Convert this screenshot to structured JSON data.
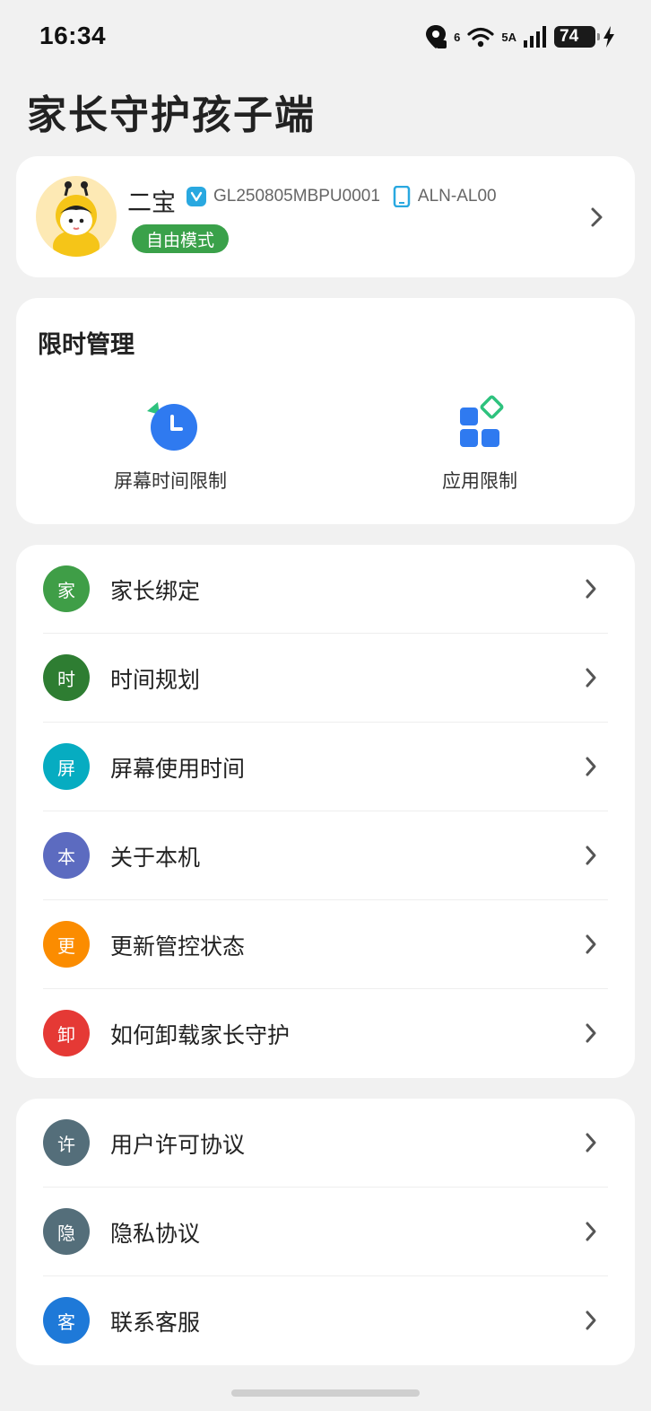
{
  "status_bar": {
    "time": "16:34",
    "network_6": "6",
    "network_5a": "5A",
    "battery": "74"
  },
  "page": {
    "title": "家长守护孩子端"
  },
  "profile": {
    "name": "二宝",
    "device_id": "GL250805MBPU0001",
    "device_model": "ALN-AL00",
    "mode": "自由模式"
  },
  "time_management": {
    "title": "限时管理",
    "items": [
      {
        "label": "屏幕时间限制",
        "icon": "clock-icon"
      },
      {
        "label": "应用限制",
        "icon": "apps-icon"
      }
    ]
  },
  "menu_main": [
    {
      "glyph": "家",
      "label": "家长绑定",
      "color": "#3f9e47"
    },
    {
      "glyph": "时",
      "label": "时间规划",
      "color": "#2e7d32"
    },
    {
      "glyph": "屏",
      "label": "屏幕使用时间",
      "color": "#06acc1"
    },
    {
      "glyph": "本",
      "label": "关于本机",
      "color": "#5c6bc0"
    },
    {
      "glyph": "更",
      "label": "更新管控状态",
      "color": "#fb8c00"
    },
    {
      "glyph": "卸",
      "label": "如何卸载家长守护",
      "color": "#e53935"
    }
  ],
  "menu_info": [
    {
      "glyph": "许",
      "label": "用户许可协议",
      "color": "#546e7a"
    },
    {
      "glyph": "隐",
      "label": "隐私协议",
      "color": "#546e7a"
    },
    {
      "glyph": "客",
      "label": "联系客服",
      "color": "#1e79d8"
    }
  ]
}
